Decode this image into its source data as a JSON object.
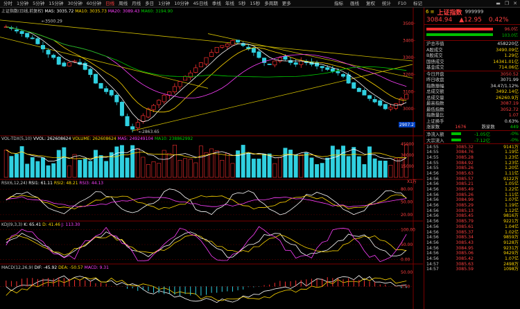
{
  "toolbar": {
    "periods": [
      "分时",
      "1分钟",
      "5分钟",
      "15分钟",
      "30分钟",
      "60分钟",
      "日线",
      "周线",
      "月线",
      "多日",
      "1分钟",
      "10分钟",
      "45日线",
      "季线",
      "年线",
      "5秒",
      "15秒",
      "多周期",
      "更多"
    ],
    "active_index": 6,
    "right_menu": [
      "指标",
      "画线",
      "复权",
      "统计",
      "F10",
      "标记"
    ]
  },
  "main": {
    "title": "上证指数(日线,前复权)",
    "ma": [
      {
        "label": "MA5: 3035.72",
        "color": "#ffffff"
      },
      {
        "label": "MA10: 3035.73",
        "color": "#ffd700"
      },
      {
        "label": "MA20: 3089.43",
        "color": "#ff40ff"
      },
      {
        "label": "MA60: 3194.90",
        "color": "#00d000"
      }
    ],
    "yaxis": [
      "3500",
      "3400",
      "3300",
      "3200",
      "3100",
      "3000",
      "2900"
    ],
    "high_label": "3500.29",
    "low_label": "2863.65",
    "current_tag": "2907.2"
  },
  "vol": {
    "title": "VOL-TDX(5,10)",
    "items": [
      {
        "label": "VVOL: 262608624",
        "color": "#ffffff"
      },
      {
        "label": "VOLUME: 262608624",
        "color": "#ffd700"
      },
      {
        "label": "MA5: 249249104",
        "color": "#ff40ff"
      },
      {
        "label": "MA10: 238862992",
        "color": "#00d000"
      }
    ],
    "yaxis": [
      "45000",
      "30000",
      "15000"
    ],
    "unit": "X1万"
  },
  "rsi": {
    "title": "RSI(6,12,24)",
    "items": [
      {
        "label": "RSI1: 61.11",
        "color": "#ffffff"
      },
      {
        "label": "RSI2: 48.21",
        "color": "#ffd700"
      },
      {
        "label": "RSI3: 44.13",
        "color": "#ff40ff"
      }
    ],
    "yaxis": [
      "80.00",
      "50.00",
      "20.00"
    ]
  },
  "kdj": {
    "title": "KDJ(9,3,3)",
    "items": [
      {
        "label": "K: 65.41",
        "color": "#ffffff"
      },
      {
        "label": "D: 41.46",
        "color": "#ffd700"
      },
      {
        "label": "J: 113.30",
        "color": "#ff40ff"
      }
    ],
    "yaxis": [
      "100.00",
      "50.00",
      "0.00"
    ]
  },
  "macd": {
    "title": "MACD(12,26,9)",
    "items": [
      {
        "label": "DIF: -45.92",
        "color": "#ffffff"
      },
      {
        "label": "DEA: -50.57",
        "color": "#ffd700"
      },
      {
        "label": "MACD: 9.31",
        "color": "#ff40ff"
      }
    ],
    "yaxis": [
      "50.00",
      "0.00"
    ]
  },
  "panel": {
    "code": "6 ≡",
    "name": "上证指数",
    "number": "999999",
    "price": "3084.94",
    "change": "▲12.95",
    "pct": "0.42%",
    "ratio_up": "96.0亿",
    "ratio_down": "103.0亿",
    "stats": [
      {
        "k": "沪总市值",
        "v": "458220亿",
        "c": "wht"
      },
      {
        "k": "A股成交",
        "v": "3490.09亿",
        "c": "yel"
      },
      {
        "k": "B股成交",
        "v": "1.29亿",
        "c": "yel"
      },
      {
        "k": "国债成交",
        "v": "14341.01亿",
        "c": "yel"
      },
      {
        "k": "基金成交",
        "v": "714.06亿",
        "c": "yel"
      }
    ],
    "stats2": [
      {
        "k": "今日开盘",
        "v": "3050.52",
        "c": "red"
      },
      {
        "k": "昨日收盘",
        "v": "3071.99",
        "c": "wht"
      },
      {
        "k": "指数振幅",
        "v": "34.47/1.12%",
        "c": "wht"
      },
      {
        "k": "总成交额",
        "v": "3492.14亿",
        "c": "yel"
      },
      {
        "k": "总成交量",
        "v": "26260.9万",
        "c": "yel"
      },
      {
        "k": "最高指数",
        "v": "3087.19",
        "c": "red"
      },
      {
        "k": "最低指数",
        "v": "3052.72",
        "c": "red"
      },
      {
        "k": "指数量比",
        "v": "1.07",
        "c": "red"
      },
      {
        "k": "上证换手",
        "v": "0.63%",
        "c": "wht"
      }
    ],
    "updown": {
      "k": "涨家数",
      "v": "1676",
      "k2": "跌家数",
      "v2": "449"
    },
    "flows": [
      {
        "k": "净流入额",
        "v": "-1.05亿",
        "p": "-0%"
      },
      {
        "k": "大宗流入",
        "v": "-7.12亿",
        "p": "-0%"
      }
    ],
    "ticks": [
      {
        "t": "14:55",
        "p": "3085.32",
        "v": "9141万",
        "c": "red"
      },
      {
        "t": "14:55",
        "p": "3084.76",
        "v": "1.19亿",
        "c": "red"
      },
      {
        "t": "14:55",
        "p": "3085.28",
        "v": "1.23亿",
        "c": "red"
      },
      {
        "t": "14:55",
        "p": "3084.92",
        "v": "1.23亿",
        "c": "red"
      },
      {
        "t": "14:55",
        "p": "3085.26",
        "v": "1.20亿",
        "c": "red"
      },
      {
        "t": "14:56",
        "p": "3085.63",
        "v": "1.11亿",
        "c": "red"
      },
      {
        "t": "14:56",
        "p": "3085.57",
        "v": "9122万",
        "c": "red"
      },
      {
        "t": "14:56",
        "p": "3085.21",
        "v": "1.05亿",
        "c": "red"
      },
      {
        "t": "14:56",
        "p": "3085.49",
        "v": "1.22亿",
        "c": "red"
      },
      {
        "t": "14:56",
        "p": "3085.26",
        "v": "1.11亿",
        "c": "red"
      },
      {
        "t": "14:56",
        "p": "3084.99",
        "v": "1.07亿",
        "c": "red"
      },
      {
        "t": "14:56",
        "p": "3085.29",
        "v": "1.19亿",
        "c": "red"
      },
      {
        "t": "14:56",
        "p": "3085.13",
        "v": "1.12亿",
        "c": "red"
      },
      {
        "t": "14:56",
        "p": "3085.45",
        "v": "9816万",
        "c": "red"
      },
      {
        "t": "14:56",
        "p": "3085.79",
        "v": "9221万",
        "c": "red"
      },
      {
        "t": "14:56",
        "p": "3085.61",
        "v": "1.04亿",
        "c": "red"
      },
      {
        "t": "14:56",
        "p": "3085.37",
        "v": "1.02亿",
        "c": "red"
      },
      {
        "t": "14:56",
        "p": "3085.34",
        "v": "9859万",
        "c": "red"
      },
      {
        "t": "14:56",
        "p": "3085.43",
        "v": "9128万",
        "c": "red"
      },
      {
        "t": "14:56",
        "p": "3084.95",
        "v": "9231万",
        "c": "red"
      },
      {
        "t": "14:56",
        "p": "3085.06",
        "v": "9429万",
        "c": "red"
      },
      {
        "t": "14:56",
        "p": "3085.42",
        "v": "1.07亿",
        "c": "red"
      },
      {
        "t": "14:57",
        "p": "3085.63",
        "v": "2498万",
        "c": "red"
      },
      {
        "t": "14:57",
        "p": "3085.59",
        "v": "1098万",
        "c": "red"
      }
    ]
  },
  "chart_data": {
    "type": "candlestick",
    "title": "上证指数(日线,前复权)",
    "ylim": [
      2850,
      3560
    ],
    "high": 3500.29,
    "low": 2863.65,
    "close_series_approx": [
      3480,
      3470,
      3455,
      3440,
      3420,
      3410,
      3380,
      3350,
      3320,
      3300,
      3260,
      3250,
      3270,
      3280,
      3260,
      3230,
      3200,
      3150,
      3120,
      3100,
      3080,
      3040,
      2960,
      2900,
      2880,
      2920,
      2960,
      3000,
      3020,
      3050,
      3080,
      3100,
      3130,
      3160,
      3190,
      3210,
      3240,
      3270,
      3300,
      3330,
      3360,
      3370,
      3380,
      3400,
      3390,
      3370,
      3350,
      3330,
      3300,
      3270,
      3260,
      3280,
      3300,
      3290,
      3270,
      3260,
      3280,
      3270,
      3260,
      3250,
      3240,
      3230,
      3220,
      3210,
      3190,
      3150,
      3120,
      3100,
      3080,
      3060,
      3040,
      3020,
      3000,
      3010,
      3030,
      3060,
      3085
    ]
  }
}
